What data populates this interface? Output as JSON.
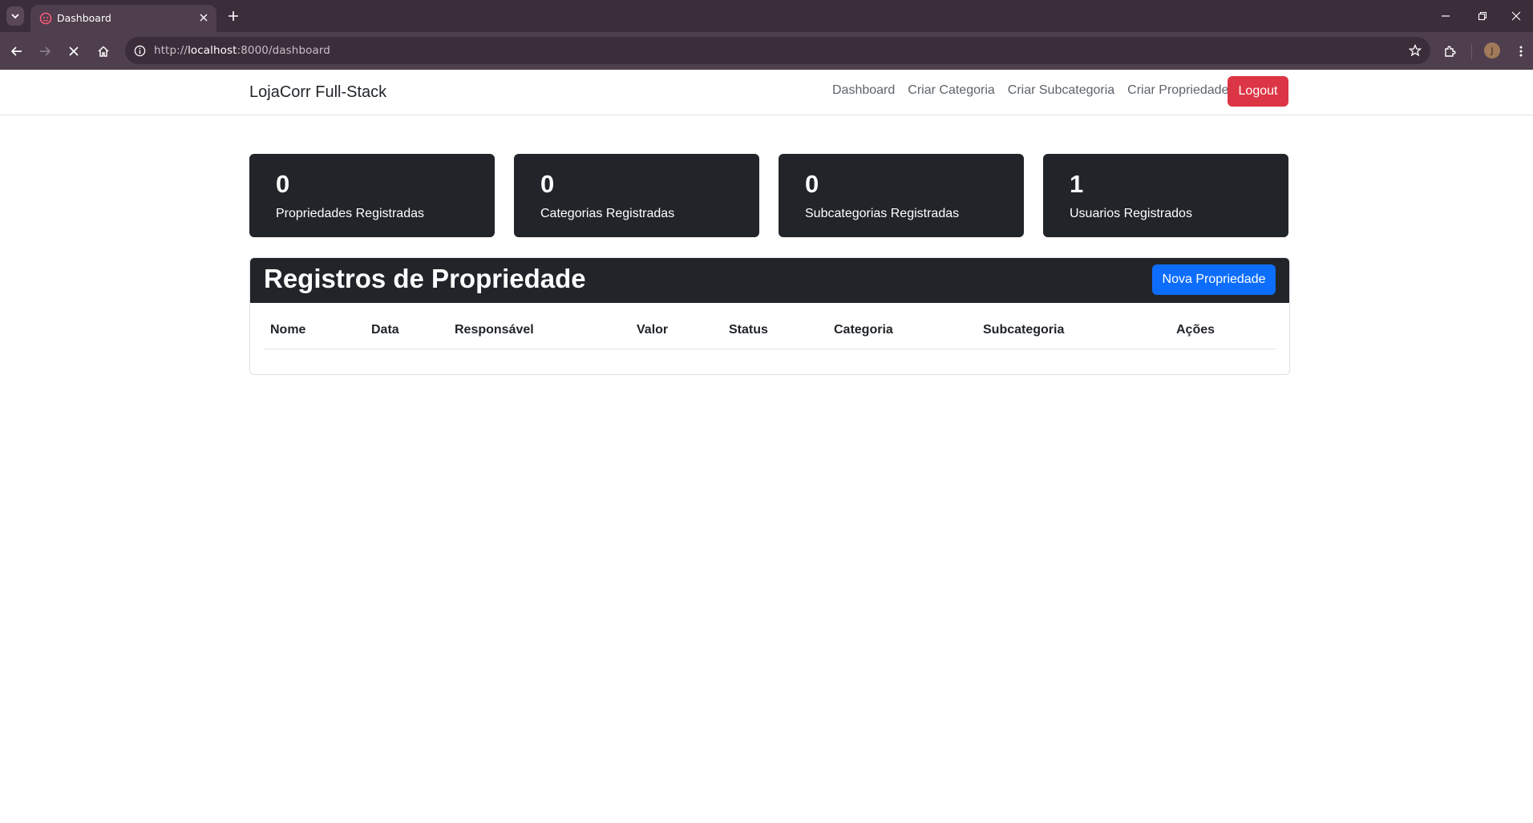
{
  "browser": {
    "tab_title": "Dashboard",
    "url_scheme": "http://",
    "url_host": "localhost",
    "url_rest": ":8000/dashboard",
    "profile_initial": "J"
  },
  "navbar": {
    "brand": "LojaCorr Full-Stack",
    "links": [
      "Dashboard",
      "Criar Categoria",
      "Criar Subcategoria",
      "Criar Propriedade"
    ],
    "logout_label": "Logout"
  },
  "stats": [
    {
      "count": "0",
      "label": "Propriedades Registradas"
    },
    {
      "count": "0",
      "label": "Categorias Registradas"
    },
    {
      "count": "0",
      "label": "Subcategorias Registradas"
    },
    {
      "count": "1",
      "label": "Usuarios Registrados"
    }
  ],
  "panel": {
    "title": "Registros de Propriedade",
    "new_button": "Nova Propriedade",
    "columns": [
      "Nome",
      "Data",
      "Responsável",
      "Valor",
      "Status",
      "Categoria",
      "Subcategoria",
      "Ações"
    ],
    "rows": []
  },
  "colors": {
    "danger": "#dc3545",
    "primary": "#0d6efd",
    "dark": "#212529"
  }
}
